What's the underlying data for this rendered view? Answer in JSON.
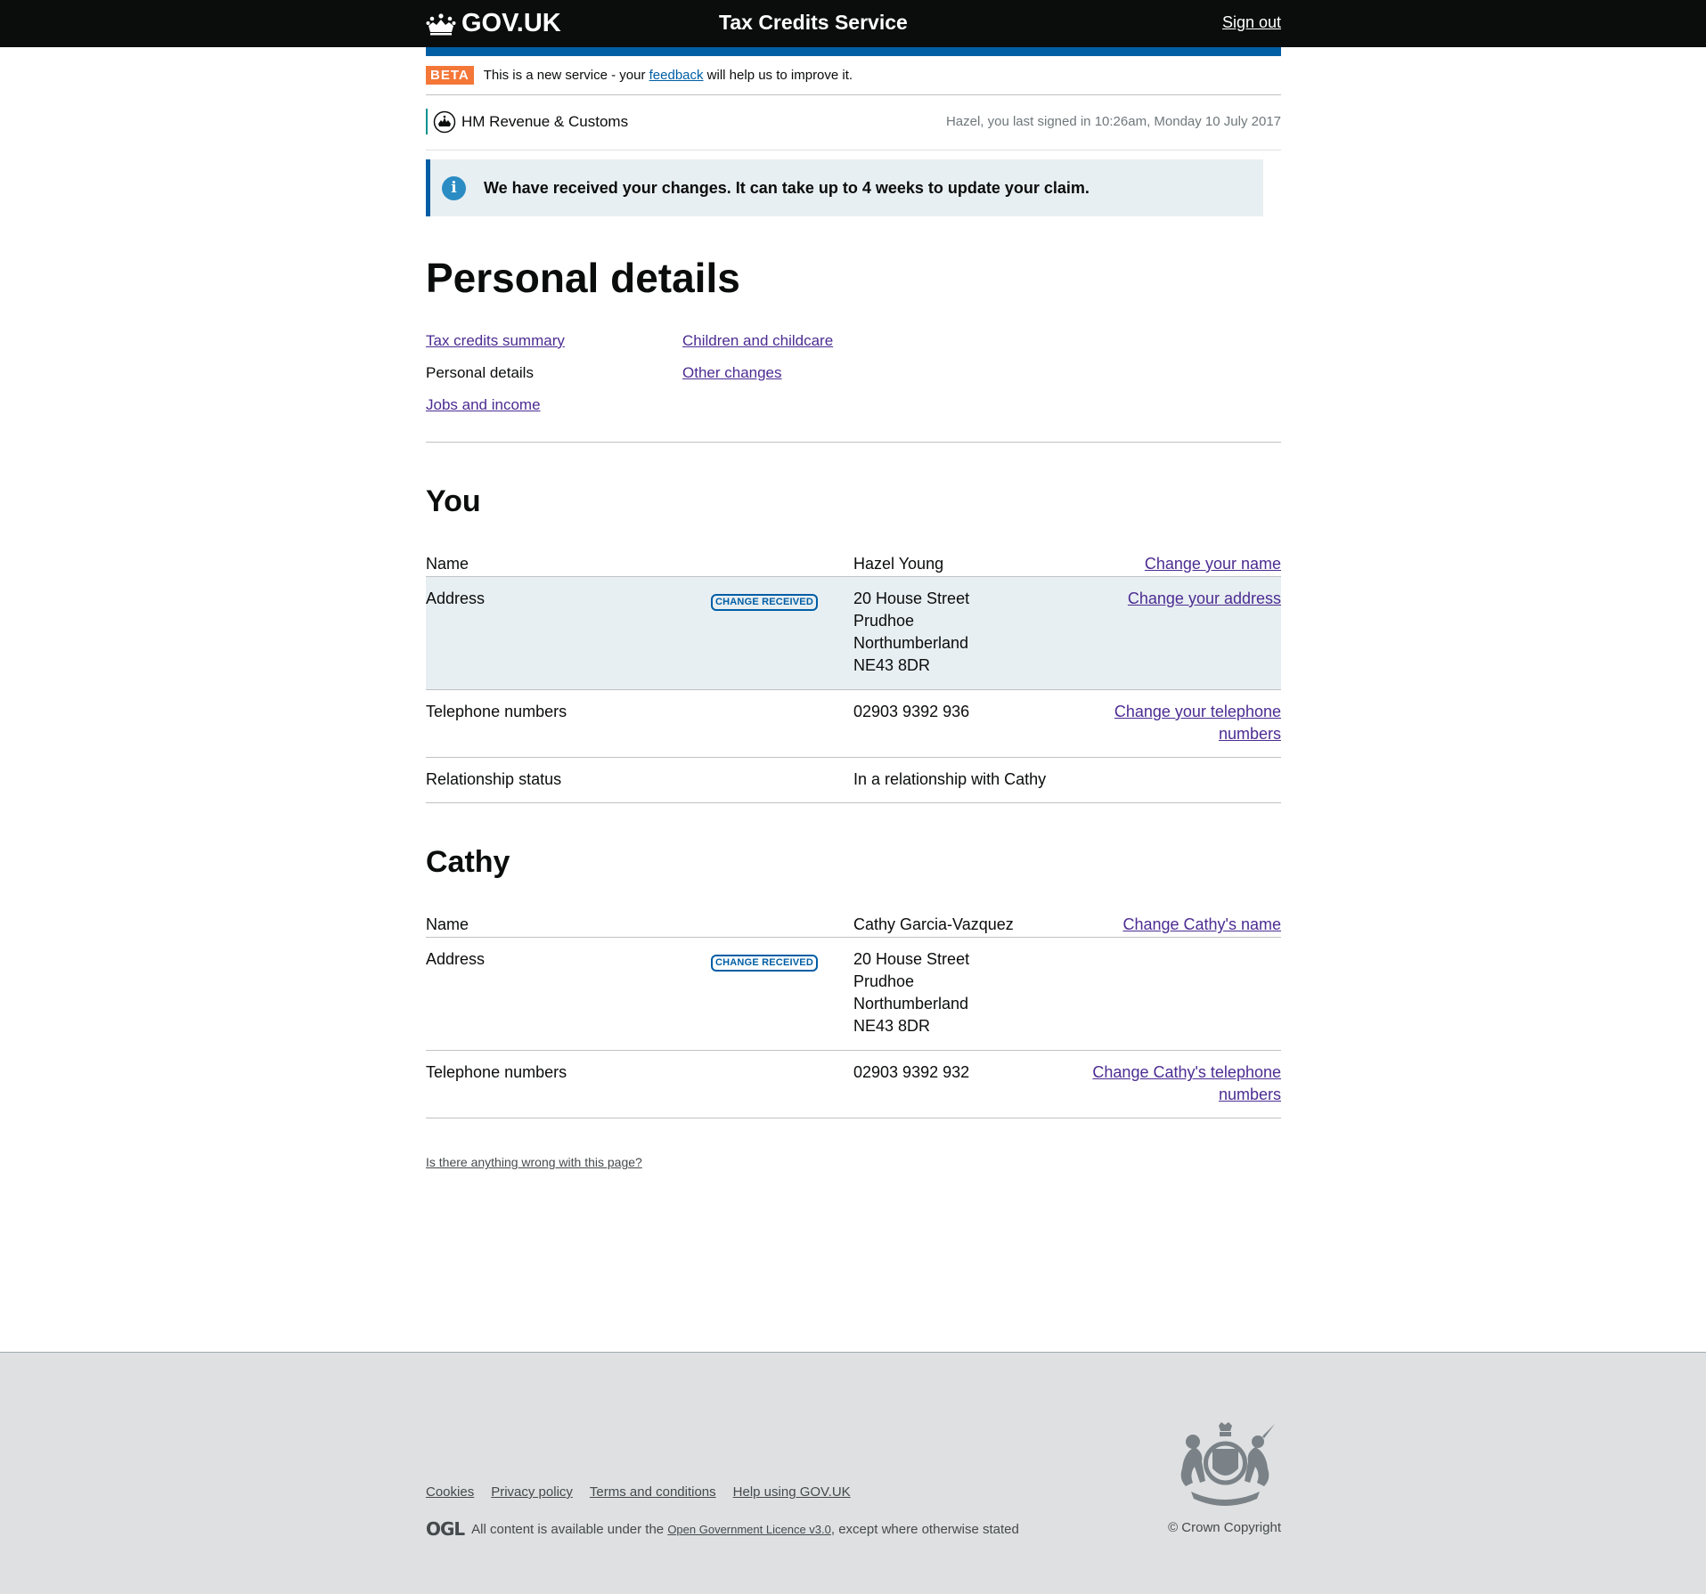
{
  "header": {
    "logo_text": "GOV.UK",
    "service_name": "Tax Credits Service",
    "sign_out": "Sign out"
  },
  "beta_banner": {
    "tag": "BETA",
    "text_before": "This is a new service - your ",
    "link": "feedback",
    "text_after": " will help us to improve it."
  },
  "organisation": {
    "name": "HM Revenue & Customs",
    "last_signed_in": "Hazel, you last signed in 10:26am, Monday 10 July 2017"
  },
  "notice": {
    "icon": "i",
    "text": "We have received your changes. It can take up to 4 weeks to update your claim."
  },
  "page_title": "Personal details",
  "subnav": {
    "col1": [
      {
        "label": "Tax credits summary",
        "current": false
      },
      {
        "label": "Personal details",
        "current": true
      },
      {
        "label": "Jobs and income",
        "current": false
      }
    ],
    "col2": [
      {
        "label": "Children and childcare",
        "current": false
      },
      {
        "label": "Other changes",
        "current": false
      }
    ]
  },
  "you": {
    "heading": "You",
    "rows": [
      {
        "key": "Name",
        "value": "Hazel Young",
        "action": "Change your name"
      },
      {
        "key": "Address",
        "tag": "CHANGE RECEIVED",
        "value_lines": [
          "20 House Street",
          "Prudhoe",
          "Northumberland",
          "NE43 8DR"
        ],
        "action": "Change your address"
      },
      {
        "key": "Telephone numbers",
        "value": "02903 9392 936",
        "action": "Change your telephone numbers"
      },
      {
        "key": "Relationship status",
        "value": "In a relationship with Cathy"
      }
    ]
  },
  "cathy": {
    "heading": "Cathy",
    "rows": [
      {
        "key": "Name",
        "value": "Cathy Garcia-Vazquez",
        "action": "Change Cathy's name"
      },
      {
        "key": "Address",
        "tag": "CHANGE RECEIVED",
        "value_lines": [
          "20 House Street",
          "Prudhoe",
          "Northumberland",
          "NE43 8DR"
        ]
      },
      {
        "key": "Telephone numbers",
        "value": "02903 9392 932",
        "action": "Change Cathy's telephone numbers"
      }
    ]
  },
  "report_link": "Is there anything wrong with this page?",
  "footer": {
    "links": [
      "Cookies",
      "Privacy policy",
      "Terms and conditions",
      "Help using GOV.UK"
    ],
    "ogl_logo": "OGL",
    "licence_before": "All content is available under the ",
    "licence_link": "Open Government Licence v3.0",
    "licence_after": ", except where otherwise stated",
    "copyright": "© Crown Copyright"
  },
  "colors": {
    "header_bg": "#0b0c0c",
    "brand_blue": "#005ea5",
    "beta_orange": "#f47738",
    "link_purple": "#4c2c92",
    "highlight_bg": "#e8eff2",
    "footer_bg": "#dee0e2"
  }
}
